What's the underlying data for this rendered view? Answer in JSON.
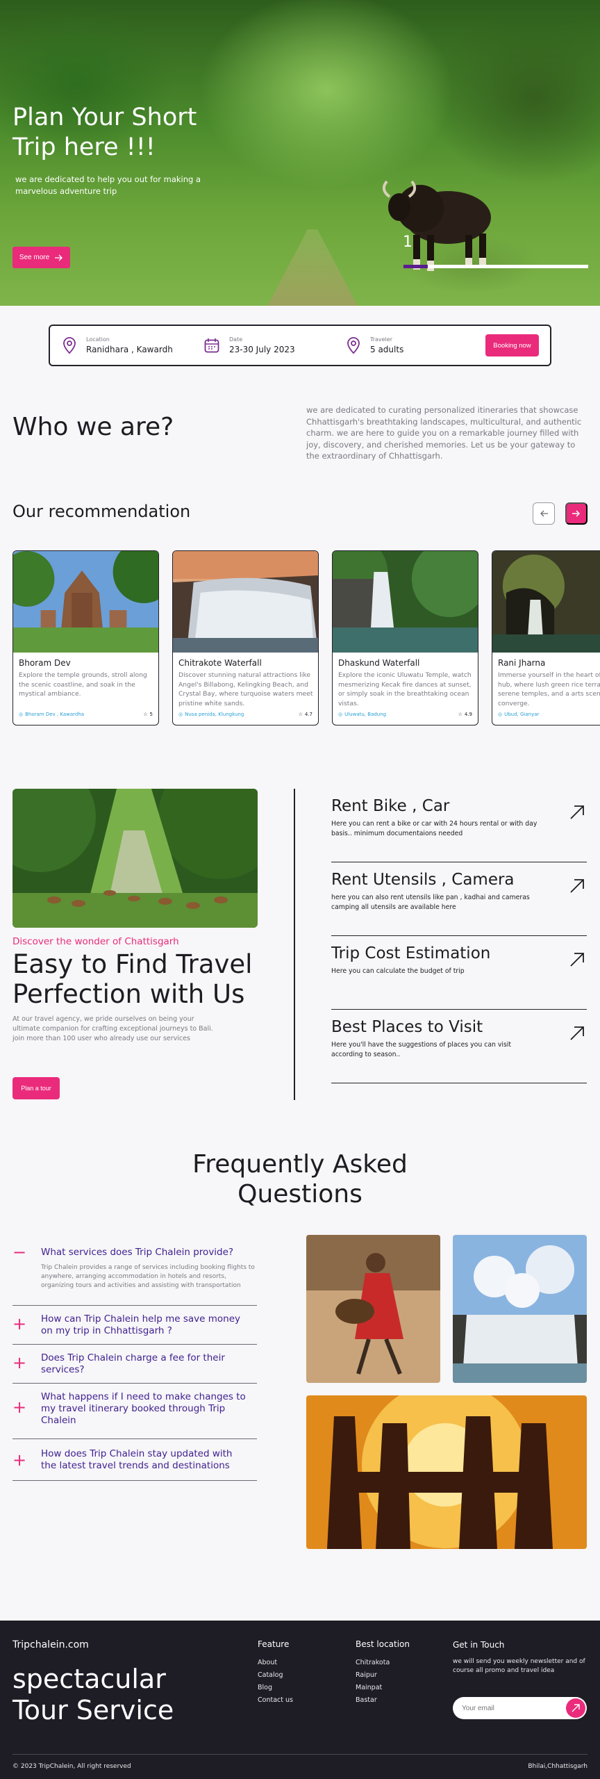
{
  "hero": {
    "title": "Plan Your Short Trip here !!!",
    "subtitle": "we are dedicated to help you out for making a marvelous adventure trip",
    "cta_label": "See more",
    "slide_number": "1",
    "slide_progress": 0.13
  },
  "booking": {
    "location_label": "Location",
    "location_value": "Ranidhara , Kawardh",
    "date_label": "Date",
    "date_value": "23-30 July 2023",
    "traveler_label": "Traveler",
    "traveler_value": "5 adults",
    "button_label": "Booking now"
  },
  "about": {
    "title": "Who we are?",
    "description": "we are dedicated to curating personalized itineraries that showcase Chhattisgarh's breathtaking landscapes, multicultural, and authentic charm. we are here to guide you on a remarkable journey filled with joy, discovery, and cherished memories. Let us be your gateway to the extraordinary of Chhattisgarh."
  },
  "recommendation": {
    "title": "Our recommendation",
    "cards": [
      {
        "title": "Bhoram Dev",
        "description": "Explore the temple grounds, stroll along the scenic coastline, and soak in the mystical ambiance.",
        "location": "Bhoram Dev , Kawardha",
        "rating": "5"
      },
      {
        "title": "Chitrakote Waterfall",
        "description": "Discover stunning natural attractions like Angel's Billabong, Kelingking Beach, and Crystal Bay, where turquoise waters meet pristine white sands.",
        "location": "Nusa penida, Klungkung",
        "rating": "4.7"
      },
      {
        "title": "Dhaskund Waterfall",
        "description": "Explore the iconic Uluwatu Temple, watch mesmerizing Kecak fire dances at sunset, or simply soak in the breathtaking ocean vistas.",
        "location": "Uluwatu, Badung",
        "rating": "4.9"
      },
      {
        "title": "Rani Jharna",
        "description": "Immerse yourself in the heart of cultural hub, where lush green rice terraces, serene temples, and a arts scene converge.",
        "location": "Ubud, Gianyar",
        "rating": ""
      }
    ]
  },
  "feature": {
    "eyebrow": "Discover the wonder of Chattisgarh",
    "title": "Easy to Find Travel Perfection with Us",
    "description": "At our travel agency, we pride ourselves on being your ultimate companion for crafting exceptional journeys to Bali. join more than 100 user who already use our services",
    "button_label": "Plan a tour"
  },
  "services": [
    {
      "title": "Rent Bike , Car",
      "description": "Here you can rent a bike or car with 24 hours rental or with day basis.. minimum documentaions needed"
    },
    {
      "title": "Rent Utensils , Camera",
      "description": "here you can also rent utensils like pan , kadhai and cameras camping all utensils are available here"
    },
    {
      "title": "Trip Cost Estimation",
      "description": "Here you can calculate the budget of trip"
    },
    {
      "title": "Best Places to Visit",
      "description": "Here you'll have the suggestions of places you can visit according to season.."
    }
  ],
  "faq": {
    "title": "Frequently Asked Questions",
    "items": [
      {
        "question": "What services does Trip Chalein provide?",
        "answer": "Trip Chalein provides a range of services including booking flights to anywhere, arranging accommodation in hotels and resorts, organizing tours and activities and assisting with transportation",
        "icon": "minus",
        "expanded": true
      },
      {
        "question": "How can Trip Chalein help me save money on my trip in Chhattisgarh ?",
        "icon": "plus",
        "expanded": false
      },
      {
        "question": "Does Trip Chalein charge a fee for their services?",
        "icon": "plus",
        "expanded": false
      },
      {
        "question": "What happens if I need to make changes to my travel itinerary booked through Trip Chalein",
        "icon": "plus",
        "expanded": false
      },
      {
        "question": "How does Trip Chalein stay updated with the latest travel trends and destinations",
        "icon": "plus",
        "expanded": false
      }
    ]
  },
  "footer": {
    "brand": "Tripchalein.com",
    "tagline": "spectacular Tour Service",
    "feature_heading": "Feature",
    "feature_links": [
      "About",
      "Catalog",
      "Blog",
      "Contact us"
    ],
    "location_heading": "Best location",
    "location_links": [
      "Chitrakota",
      "Raipur",
      "Mainpat",
      "Bastar"
    ],
    "touch_heading": "Get in Touch",
    "touch_description": "we will send you weekly newsletter and of course all promo and travel idea",
    "email_placeholder": "Your email",
    "copyright": "© 2023 TripChalein, All right reserved",
    "location": "Bhilai,Chhattisgarh"
  },
  "colors": {
    "accent": "#ea2b7b",
    "dark": "#1e1d26",
    "faq_question": "#3e1f8f",
    "progress": "#5a1d8f"
  }
}
